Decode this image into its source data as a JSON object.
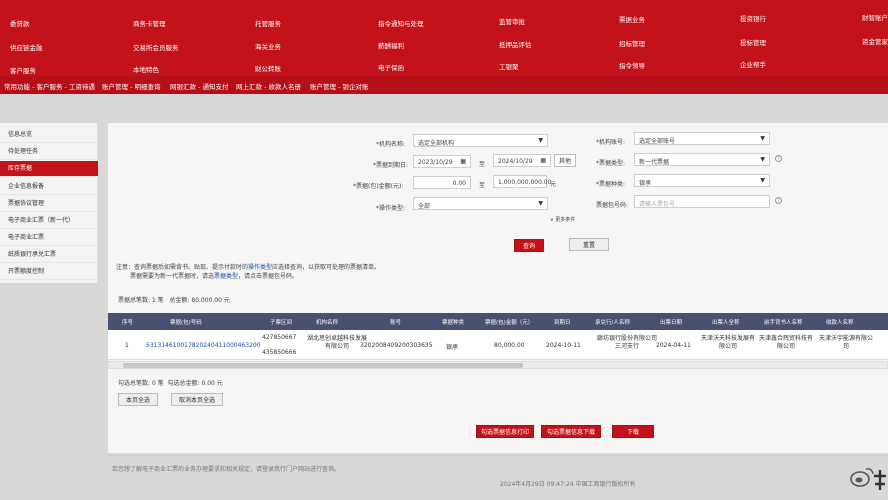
{
  "topnav": {
    "row1": [
      "委贷款",
      "商务卡管理",
      "托管服务",
      "指令通知与处理",
      "监管审批",
      "票据业务",
      "投资银行",
      "财智账户"
    ],
    "row2": [
      "供应链金融",
      "交易所会员服务",
      "海关业务",
      "薪酬福利",
      "抵押品评估",
      "招标管理",
      "投标管理",
      "资金管家"
    ],
    "row3": [
      "客户服务",
      "本地特色",
      "财公转账",
      "电子保函",
      "工银聚",
      "指令领导",
      "企业帮手"
    ]
  },
  "subbar": [
    "常用功能 - 客户服务 - 工资待遇",
    "账户管理 - 明细查询",
    "网银汇款 - 通知支付",
    "网上汇款 - 收款人名册",
    "账户管理 - 银企对账"
  ],
  "sidebar": {
    "items": [
      "信息总览",
      "待处理任务",
      "库存票据",
      "企业信息报备",
      "票据协议管理",
      "电子商业汇票（新一代）",
      "电子商业汇票",
      "纸质银行承兑汇票",
      "开票额度控制"
    ],
    "active_index": 2
  },
  "form": {
    "org_label": "*机构名称:",
    "org_value": "选定全部机构",
    "acct_label": "*机构账号:",
    "acct_value": "选定全部账号",
    "date_label": "*票据到期日:",
    "date_from": "2023/10/29",
    "date_to_sep": "至",
    "date_to": "2024/10/29",
    "date_other": "其他",
    "type_label": "*票据类型:",
    "type_value": "新一代票据",
    "amount_label": "*票据(包)金额(元):",
    "amount_from": "0.00",
    "amount_to_sep": "至",
    "amount_to": "1,000,000,000.00",
    "amount_unit": "元",
    "kind_label": "*票据种类:",
    "kind_value": "银承",
    "op_label": "*操作类型:",
    "op_value": "全部",
    "num_label": "票据包号码:",
    "num_placeholder": "请输入票包号",
    "more_label": "更多条件",
    "query_btn": "查询",
    "reset_btn": "重置"
  },
  "notice": {
    "line1_a": "注意：查询票据后如需背书、贴现、提示付款时的",
    "line1_link": "操作类型",
    "line1_b": "应选择查询，以获取可处理的票据清单。",
    "line2_a": "票据需要为新一代票据时，请选",
    "line2_link": "票据类型",
    "line2_b": "，请点击票据包号码。"
  },
  "summary": {
    "count_label": "票据总笔数:",
    "count_value": "1 笔",
    "total_label": "总金额:",
    "total_value": "80,000.00 元"
  },
  "table": {
    "headers": [
      "序号",
      "票据(包)号码",
      "子票区间",
      "机构名称",
      "账号",
      "票据种类",
      "票据(包)金额（元）",
      "到期日",
      "承兑行/人名称",
      "出票日期",
      "出票人全称",
      "前手背书人名称",
      "收款人名称"
    ],
    "row": {
      "index": "1",
      "number": "531314610017820240411000463200",
      "range_a": "427850667",
      "range_b": "435850666",
      "org": "湖北思创卓越科技发展有限公司",
      "account": "3202008409200303635",
      "kind": "银承",
      "amount": "80,000.00",
      "due": "2024-10-11",
      "acceptor": "廊坊银行股份有限公司三河支行",
      "issue_date": "2024-04-11",
      "drawer": "天津沃天科技发展有限公司",
      "endorser": "天津鑫合辉贸科技有限公司",
      "payee": "天津沃宇能源有限公司"
    }
  },
  "selection": {
    "count_label": "勾选总笔数:",
    "count_value": "0 笔",
    "amount_label": "勾选总金额:",
    "amount_value": "0.00 元",
    "select_page": "本页全选",
    "deselect_page": "取消本页全选"
  },
  "actions": {
    "print": "勾选票据信息打印",
    "download_info": "勾选票据信息下载",
    "download": "下载"
  },
  "footer": {
    "note": "若您想了解电子商业汇票的业务办理要求和相关规定，请登录我行门户网站进行查询。",
    "copyright": "2024年4月29日 09:47:24    中国工商银行版权所有"
  },
  "colors": {
    "brand_red": "#c4121a",
    "table_header": "#4a5070",
    "link_blue": "#1a4ea0"
  }
}
